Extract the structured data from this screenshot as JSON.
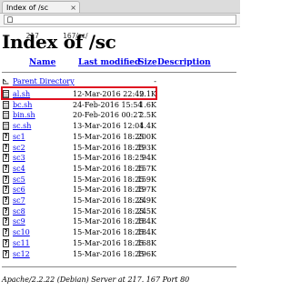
{
  "browser": {
    "tab_title": "Index of /sc",
    "tab_close": "×",
    "url": "217           167/sc/"
  },
  "page": {
    "title": "Index of /sc",
    "headers": {
      "name": "Name",
      "modified": "Last modified",
      "size": "Size",
      "description": "Description"
    },
    "parent": {
      "name": "Parent Directory",
      "size": "-"
    },
    "files": [
      {
        "name": "al.sh",
        "date": "12-Mar-2016 22:49",
        "size": "2.1K",
        "icon": "text"
      },
      {
        "name": "bc.sh",
        "date": "24-Feb-2016 15:54",
        "size": "1.6K",
        "icon": "text"
      },
      {
        "name": "bin.sh",
        "date": "20-Feb-2016 00:27",
        "size": "2.5K",
        "icon": "text"
      },
      {
        "name": "sc.sh",
        "date": "13-Mar-2016 12:01",
        "size": "4.4K",
        "icon": "text"
      },
      {
        "name": "sc1",
        "date": "15-Mar-2016 18:25",
        "size": "200K",
        "icon": "unknown"
      },
      {
        "name": "sc2",
        "date": "15-Mar-2016 18:25",
        "size": "193K",
        "icon": "unknown"
      },
      {
        "name": "sc3",
        "date": "15-Mar-2016 18:25",
        "size": "94K",
        "icon": "unknown"
      },
      {
        "name": "sc4",
        "date": "15-Mar-2016 18:25",
        "size": "157K",
        "icon": "unknown"
      },
      {
        "name": "sc5",
        "date": "15-Mar-2016 18:25",
        "size": "159K",
        "icon": "unknown"
      },
      {
        "name": "sc6",
        "date": "15-Mar-2016 18:25",
        "size": "197K",
        "icon": "unknown"
      },
      {
        "name": "sc7",
        "date": "15-Mar-2016 18:25",
        "size": "249K",
        "icon": "unknown"
      },
      {
        "name": "sc8",
        "date": "15-Mar-2016 18:25",
        "size": "245K",
        "icon": "unknown"
      },
      {
        "name": "sc9",
        "date": "15-Mar-2016 18:25",
        "size": "184K",
        "icon": "unknown"
      },
      {
        "name": "sc10",
        "date": "15-Mar-2016 18:25",
        "size": "184K",
        "icon": "unknown"
      },
      {
        "name": "sc11",
        "date": "15-Mar-2016 18:25",
        "size": "168K",
        "icon": "unknown"
      },
      {
        "name": "sc12",
        "date": "15-Mar-2016 18:25",
        "size": "196K",
        "icon": "unknown"
      }
    ],
    "footer": "Apache/2.2.22 (Debian) Server at 217.           167 Port 80"
  },
  "highlight_color": "#e01020",
  "link_color": "#0000ee"
}
